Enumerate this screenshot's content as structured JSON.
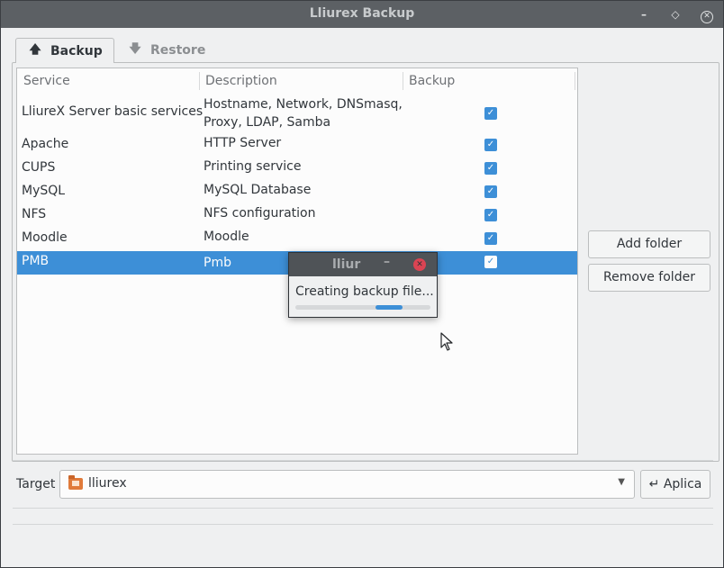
{
  "window": {
    "title": "Lliurex Backup"
  },
  "tabs": [
    {
      "label": "Backup",
      "icon": "arrow-up-icon",
      "active": true
    },
    {
      "label": "Restore",
      "icon": "arrow-down-icon",
      "active": false
    }
  ],
  "table": {
    "headers": [
      "Service",
      "Description",
      "Backup"
    ],
    "rows": [
      {
        "service": "LliureX Server basic services",
        "description_line1": "Hostname, Network, DNSmasq,",
        "description_line2": "Proxy, LDAP, Samba",
        "backup": true
      },
      {
        "service": "Apache",
        "description": "HTTP Server",
        "backup": true
      },
      {
        "service": "CUPS",
        "description": "Printing service",
        "backup": true
      },
      {
        "service": "MySQL",
        "description": "MySQL Database",
        "backup": true
      },
      {
        "service": "NFS",
        "description": "NFS configuration",
        "backup": true
      },
      {
        "service": "Moodle",
        "description": "Moodle",
        "backup": true
      },
      {
        "service": "PMB",
        "description": "Pmb",
        "backup": true,
        "selected": true
      }
    ]
  },
  "sidebar": {
    "add_folder": "Add folder",
    "remove_folder": "Remove folder"
  },
  "target": {
    "label": "Target",
    "value": "lliurex",
    "apply": "Aplica"
  },
  "popup": {
    "title": "lliur",
    "message": "Creating backup file...",
    "progress_start": 0.59,
    "progress_end": 0.79
  },
  "colors": {
    "accent": "#3d8fd7",
    "titlebar": "#5c6064",
    "window_bg": "#eff0f1",
    "close": "#da4453"
  }
}
